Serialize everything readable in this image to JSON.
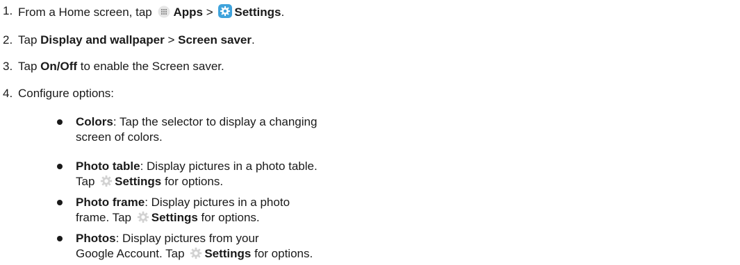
{
  "steps": [
    {
      "num": "1.",
      "pre": "From a Home screen, tap",
      "apps": "Apps",
      "sep": ">",
      "settings": "Settings",
      "end": "."
    },
    {
      "num": "2.",
      "pre": "Tap",
      "a": "Display and wallpaper",
      "sep": ">",
      "b": "Screen saver",
      "end": "."
    },
    {
      "num": "3.",
      "pre": "Tap",
      "a": "On/Off",
      "post": "to enable the Screen saver."
    },
    {
      "num": "4.",
      "text": "Configure options:"
    }
  ],
  "options": [
    {
      "term": "Colors",
      "desc1": ": Tap the selector to display a changing",
      "desc2": "screen of colors."
    },
    {
      "term": "Photo table",
      "desc1": ": Display pictures in a photo table.",
      "l2pre": "Tap",
      "l2bold": "Settings",
      "l2post": "for options."
    },
    {
      "term": "Photo frame",
      "desc1": ": Display pictures in a photo",
      "l2pre": "frame. Tap",
      "l2bold": "Settings",
      "l2post": "for options."
    },
    {
      "term": "Photos",
      "desc1": ": Display pictures from your",
      "l2pre": "Google Account. Tap",
      "l2bold": "Settings",
      "l2post": "for options."
    }
  ],
  "icons": {
    "apps": "apps-grid-icon",
    "settings_app": "settings-app-icon",
    "settings_gear": "gear-icon"
  },
  "colors": {
    "text": "#1a1a1a",
    "settings_app_bg": "#3fa3dc",
    "gear": "#d2d2d2"
  }
}
